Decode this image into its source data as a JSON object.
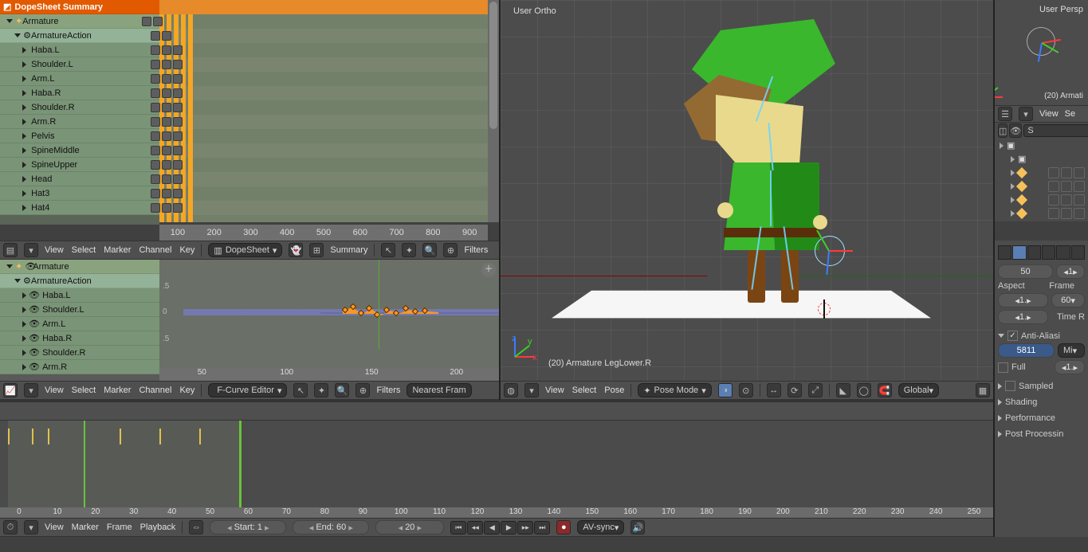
{
  "dope": {
    "summary": "DopeSheet Summary",
    "object": "Armature",
    "action": "ArmatureAction",
    "bones": [
      "Haba.L",
      "Shoulder.L",
      "Arm.L",
      "Haba.R",
      "Shoulder.R",
      "Arm.R",
      "Pelvis",
      "SpineMiddle",
      "SpineUpper",
      "Head",
      "Hat3",
      "Hat4"
    ],
    "frame": "20",
    "ticks": [
      "100",
      "200",
      "300",
      "400",
      "500",
      "600",
      "700",
      "800",
      "900"
    ]
  },
  "dope_header": {
    "menus": [
      "View",
      "Select",
      "Marker",
      "Channel",
      "Key"
    ],
    "mode": "DopeSheet",
    "summary": "Summary",
    "filters": "Filters"
  },
  "graph": {
    "object": "Armature",
    "action": "ArmatureAction",
    "bones": [
      "Haba.L",
      "Shoulder.L",
      "Arm.L",
      "Haba.R",
      "Shoulder.R",
      "Arm.R"
    ],
    "frame": "20",
    "ticks": [
      "50",
      "100",
      "150",
      "200"
    ],
    "zero": "0",
    "yticks": [
      ".5",
      ".5"
    ]
  },
  "graph_header": {
    "menus": [
      "View",
      "Select",
      "Marker",
      "Channel",
      "Key"
    ],
    "mode": "F-Curve Editor",
    "filters": "Filters",
    "nearest": "Nearest Fram"
  },
  "viewport": {
    "projection": "User Ortho",
    "info": "(20) Armature LegLower.R"
  },
  "viewport_header": {
    "menus": [
      "View",
      "Select",
      "Pose"
    ],
    "mode": "Pose Mode",
    "orient": "Global"
  },
  "mini": {
    "projection": "User Persp",
    "info": "(20) Armati"
  },
  "outliner": {
    "menu": "View",
    "search_label": "Se",
    "scene_search": "S",
    "items": [
      {
        "name": "",
        "icon": "scene",
        "depth": 0,
        "controls": false
      },
      {
        "name": "",
        "icon": "cam",
        "depth": 1,
        "controls": false
      },
      {
        "name": "",
        "icon": "bone",
        "depth": 1,
        "controls": true
      },
      {
        "name": "",
        "icon": "bone",
        "depth": 1,
        "controls": true
      },
      {
        "name": "",
        "icon": "bone",
        "depth": 1,
        "controls": true
      },
      {
        "name": "",
        "icon": "bone",
        "depth": 1,
        "controls": true
      }
    ]
  },
  "props": {
    "aspect": "Aspect",
    "frame": "Frame",
    "time": "Time R",
    "aa": "Anti-Aliasi",
    "samples": "5811",
    "samples_mode": "Mi",
    "full": "Full",
    "sampled": "Sampled",
    "shading": "Shading",
    "perf": "Performance",
    "post": "Post Processin",
    "fifty": "50",
    "one": "1",
    "oneA": "1.",
    "oneB": "1.",
    "oneC": "1.",
    "sixty": "60"
  },
  "timeline": {
    "menus": [
      "View",
      "Marker",
      "Frame",
      "Playback"
    ],
    "start_label": "Start:",
    "start": "1",
    "end_label": "End:",
    "end": "60",
    "current": "20",
    "sync": "AV-sync",
    "ticks": [
      "0",
      "10",
      "20",
      "30",
      "40",
      "50",
      "60",
      "70",
      "80",
      "90",
      "100",
      "110",
      "120",
      "130",
      "140",
      "150",
      "160",
      "170",
      "180",
      "190",
      "200",
      "210",
      "220",
      "230",
      "240",
      "250"
    ]
  }
}
